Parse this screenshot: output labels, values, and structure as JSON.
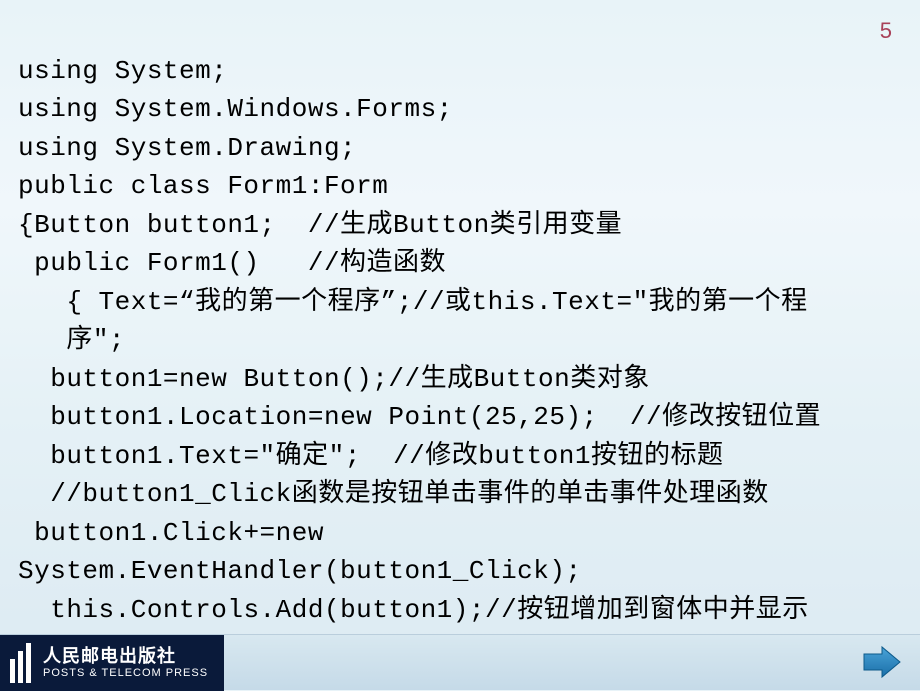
{
  "page_number": "5",
  "code": {
    "l1": "using System;",
    "l2": "using System.Windows.Forms;",
    "l3": "using System.Drawing;",
    "l4": "public class Form1:Form",
    "l5": "{Button button1;  //生成Button类引用变量",
    "l6": " public Form1()   //构造函数",
    "l7": "   { Text=“我的第一个程序”;//或this.Text=″我的第一个程",
    "l7b": "   序″;",
    "l8": "  button1=new Button();//生成Button类对象",
    "l9": "  button1.Location=new Point(25,25);  //修改按钮位置",
    "l10": "  button1.Text=″确定″;  //修改button1按钮的标题",
    "l11": "  //button1_Click函数是按钮单击事件的单击事件处理函数",
    "l12": " button1.Click+=new System.EventHandler(button1_Click);",
    "l13": "  this.Controls.Add(button1);//按钮增加到窗体中并显示",
    "l14": "   }"
  },
  "publisher": {
    "name_cn": "人民邮电出版社",
    "name_en": "POSTS & TELECOM PRESS"
  }
}
